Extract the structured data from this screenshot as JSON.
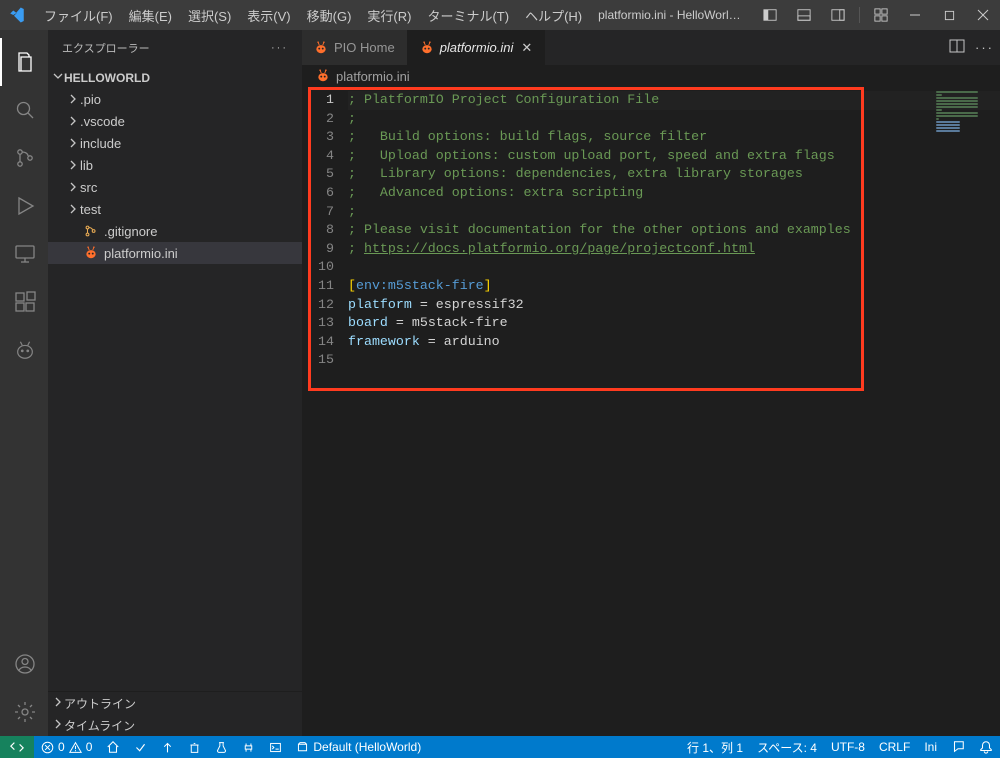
{
  "titlebar": {
    "title": "platformio.ini - HelloWorld - Visual Studio C...",
    "menus": [
      "ファイル(F)",
      "編集(E)",
      "選択(S)",
      "表示(V)",
      "移動(G)",
      "実行(R)",
      "ターミナル(T)",
      "ヘルプ(H)"
    ]
  },
  "sidebar": {
    "header": "エクスプローラー",
    "project": "HELLOWORLD",
    "tree": [
      {
        "icon": "chev",
        "label": ".pio",
        "kind": "folder"
      },
      {
        "icon": "chev",
        "label": ".vscode",
        "kind": "folder"
      },
      {
        "icon": "chev",
        "label": "include",
        "kind": "folder"
      },
      {
        "icon": "chev",
        "label": "lib",
        "kind": "folder"
      },
      {
        "icon": "chev",
        "label": "src",
        "kind": "folder"
      },
      {
        "icon": "chev",
        "label": "test",
        "kind": "folder"
      },
      {
        "icon": "git",
        "label": ".gitignore",
        "kind": "file"
      },
      {
        "icon": "pio",
        "label": "platformio.ini",
        "kind": "file",
        "active": true
      }
    ],
    "panels": [
      "アウトライン",
      "タイムライン"
    ]
  },
  "tabs": [
    {
      "icon": "pio",
      "label": "PIO Home",
      "active": false,
      "italic": false
    },
    {
      "icon": "pio",
      "label": "platformio.ini",
      "active": true,
      "italic": true
    }
  ],
  "breadcrumb": {
    "icon": "pio",
    "label": "platformio.ini"
  },
  "editor": {
    "lines": [
      {
        "n": 1,
        "t": "comment",
        "text": "; PlatformIO Project Configuration File"
      },
      {
        "n": 2,
        "t": "comment",
        "text": ";"
      },
      {
        "n": 3,
        "t": "comment",
        "text": ";   Build options: build flags, source filter"
      },
      {
        "n": 4,
        "t": "comment",
        "text": ";   Upload options: custom upload port, speed and extra flags"
      },
      {
        "n": 5,
        "t": "comment",
        "text": ";   Library options: dependencies, extra library storages"
      },
      {
        "n": 6,
        "t": "comment",
        "text": ";   Advanced options: extra scripting"
      },
      {
        "n": 7,
        "t": "comment",
        "text": ";"
      },
      {
        "n": 8,
        "t": "comment",
        "text": "; Please visit documentation for the other options and examples"
      },
      {
        "n": 9,
        "t": "link",
        "prefix": "; ",
        "text": "https://docs.platformio.org/page/projectconf.html"
      },
      {
        "n": 10,
        "t": "blank",
        "text": ""
      },
      {
        "n": 11,
        "t": "section",
        "open": "[",
        "name": "env:m5stack-fire",
        "close": "]"
      },
      {
        "n": 12,
        "t": "kv",
        "key": "platform",
        "val": "espressif32"
      },
      {
        "n": 13,
        "t": "kv",
        "key": "board",
        "val": "m5stack-fire"
      },
      {
        "n": 14,
        "t": "kv",
        "key": "framework",
        "val": "arduino"
      },
      {
        "n": 15,
        "t": "blank",
        "text": ""
      }
    ],
    "current_line": 1
  },
  "statusbar": {
    "left_text_default": "Default (HelloWorld)",
    "errors": "0",
    "warnings": "0",
    "right": {
      "pos": "行 1、列 1",
      "spaces": "スペース: 4",
      "encoding": "UTF-8",
      "eol": "CRLF",
      "lang": "Ini"
    }
  },
  "icons": {
    "pio_color": "#ff6f2c"
  }
}
